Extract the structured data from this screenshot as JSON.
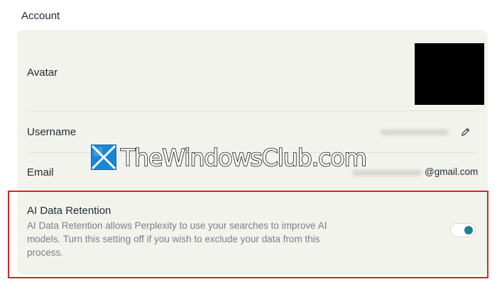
{
  "section": {
    "title": "Account"
  },
  "rows": {
    "avatar_label": "Avatar",
    "username_label": "Username",
    "email_label": "Email",
    "email_suffix": "@gmail.com"
  },
  "watermark": {
    "text": "TheWindowsClub.com"
  },
  "retention": {
    "title": "AI Data Retention",
    "description": "AI Data Retention allows Perplexity to use your searches to improve AI models. Turn this setting off if you wish to exclude your data from this process.",
    "enabled": true
  },
  "icons": {
    "edit": "pencil-edit-icon",
    "watermark_logo": "windows-logo-icon"
  },
  "colors": {
    "card_background": "#f3f3ee",
    "toggle_on": "#20808d",
    "highlight_border": "#e21f26"
  }
}
